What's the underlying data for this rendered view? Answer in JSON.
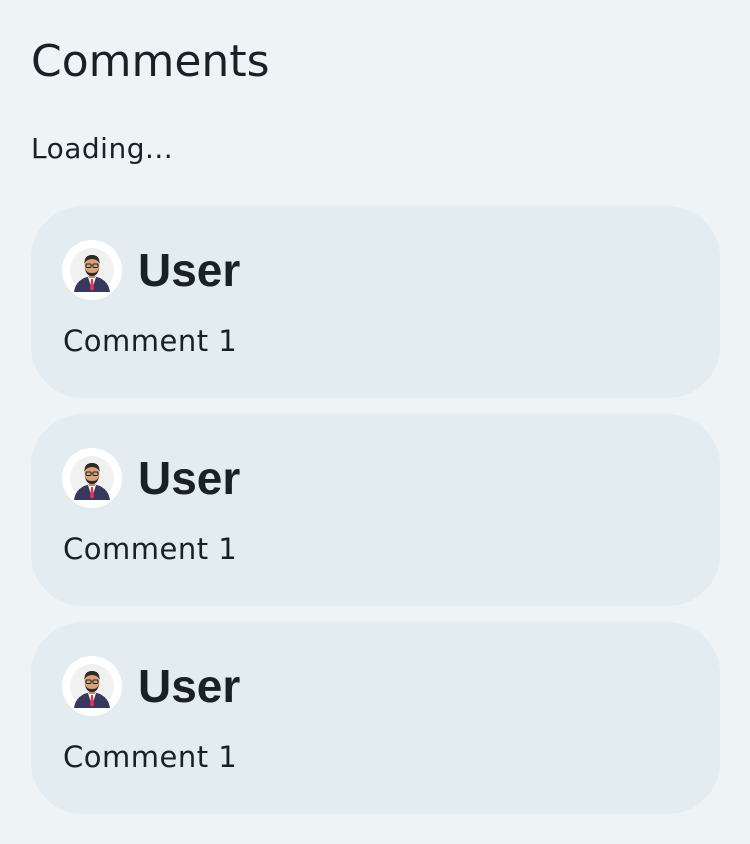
{
  "header": {
    "title": "Comments"
  },
  "status": {
    "text": "Loading..."
  },
  "comments": [
    {
      "user": "User",
      "text": "Comment 1",
      "avatar_icon": "user-avatar-icon"
    },
    {
      "user": "User",
      "text": "Comment 1",
      "avatar_icon": "user-avatar-icon"
    },
    {
      "user": "User",
      "text": "Comment 1",
      "avatar_icon": "user-avatar-icon"
    }
  ],
  "colors": {
    "background": "#eef3f6",
    "card": "#e2ecf1",
    "text": "#1a2126"
  }
}
